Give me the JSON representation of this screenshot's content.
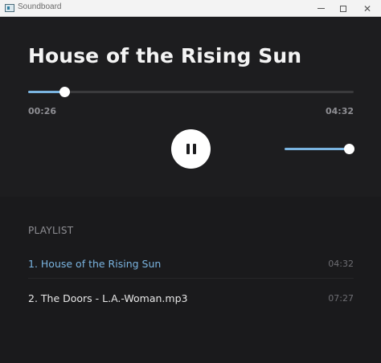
{
  "window": {
    "title": "Soundboard"
  },
  "player": {
    "song_title": "House of the Rising Sun",
    "elapsed": "00:26",
    "total": "04:32",
    "progress": 0.11,
    "volume": 1.0,
    "state": "playing",
    "accent_color": "#7ab4e0"
  },
  "playlist": {
    "header": "PLAYLIST",
    "tracks": [
      {
        "label": "1. House of the Rising Sun",
        "duration": "04:32",
        "active": true
      },
      {
        "label": "2. The Doors - L.A.-Woman.mp3",
        "duration": "07:27",
        "active": false
      }
    ]
  }
}
